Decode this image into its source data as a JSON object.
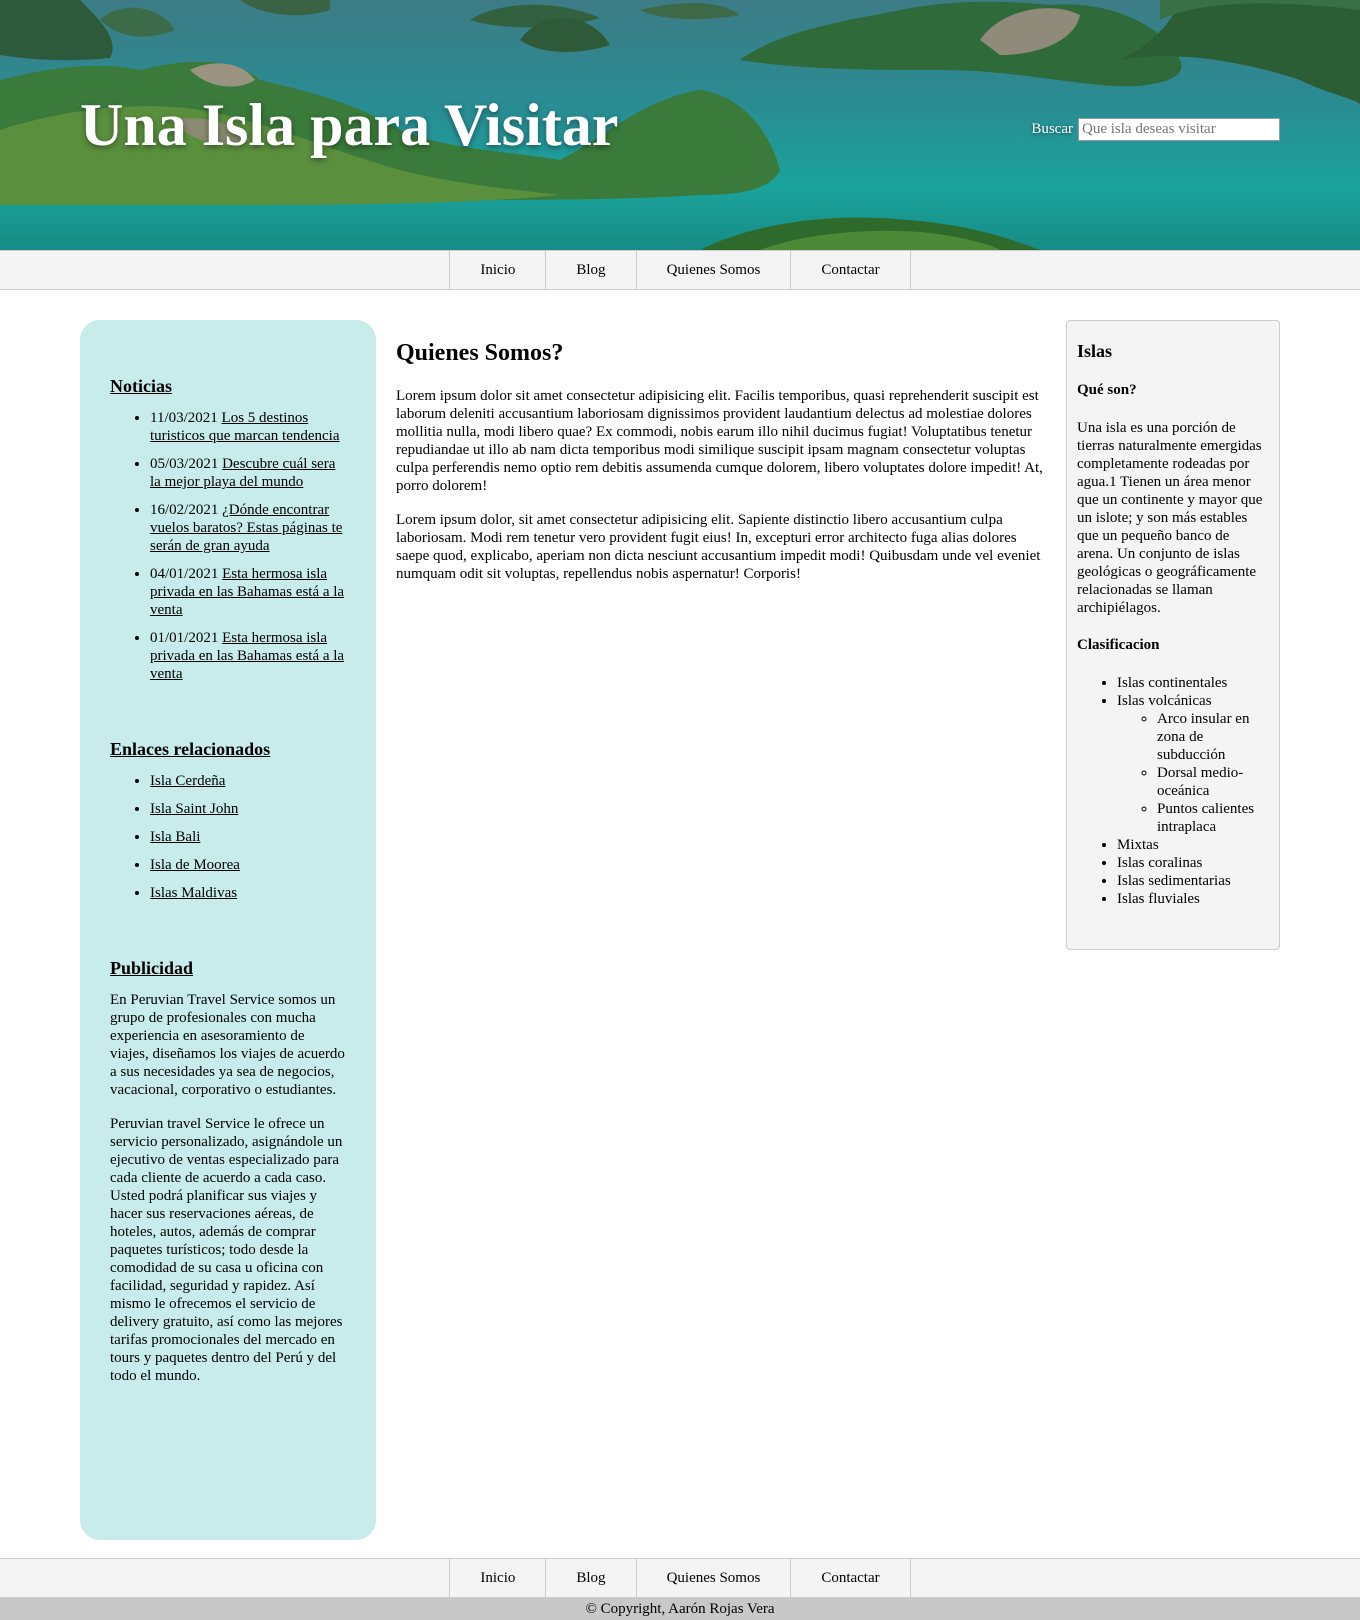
{
  "header": {
    "title": "Una Isla para Visitar",
    "search_label": "Buscar",
    "search_placeholder": "Que isla deseas visitar"
  },
  "nav": {
    "items": [
      "Inicio",
      "Blog",
      "Quienes Somos",
      "Contactar"
    ]
  },
  "sidebar": {
    "news_title": "Noticias",
    "news": [
      {
        "date": "11/03/2021",
        "text": "Los 5 destinos turisticos que marcan tendencia"
      },
      {
        "date": "05/03/2021",
        "text": "Descubre cuál sera la mejor playa del mundo"
      },
      {
        "date": "16/02/2021",
        "text": "¿Dónde encontrar vuelos baratos? Estas páginas te serán de gran ayuda"
      },
      {
        "date": "04/01/2021",
        "text": "Esta hermosa isla privada en las Bahamas está a la venta"
      },
      {
        "date": "01/01/2021",
        "text": "Esta hermosa isla privada en las Bahamas está a la venta"
      }
    ],
    "links_title": "Enlaces relacionados",
    "links": [
      "Isla Cerdeña",
      "Isla Saint John",
      "Isla Bali",
      "Isla de Moorea",
      "Islas Maldivas"
    ],
    "ads_title": "Publicidad",
    "ads_paragraphs": [
      "En Peruvian Travel Service somos un grupo de profesionales con mucha experiencia en asesoramiento de viajes, diseñamos los viajes de acuerdo a sus necesidades ya sea de negocios, vacacional, corporativo o estudiantes.",
      "Peruvian travel Service le ofrece un servicio personalizado, asignándole un ejecutivo de ventas especializado para cada cliente de acuerdo a cada caso. Usted podrá planificar sus viajes y hacer sus reservaciones aéreas, de hoteles, autos, además de comprar paquetes turísticos; todo desde la comodidad de su casa u oficina con facilidad, seguridad y rapidez. Así mismo le ofrecemos el servicio de delivery gratuito, así como las mejores tarifas promocionales del mercado en tours y paquetes dentro del Perú y del todo el mundo."
    ]
  },
  "content": {
    "title": "Quienes Somos?",
    "paragraphs": [
      "Lorem ipsum dolor sit amet consectetur adipisicing elit. Facilis temporibus, quasi reprehenderit suscipit est laborum deleniti accusantium laboriosam dignissimos provident laudantium delectus ad molestiae dolores mollitia nulla, modi libero quae? Ex commodi, nobis earum illo nihil ducimus fugiat! Voluptatibus tenetur repudiandae ut illo ab nam dicta temporibus modi similique suscipit ipsam magnam consectetur voluptas culpa perferendis nemo optio rem debitis assumenda cumque dolorem, libero voluptates dolore impedit! At, porro dolorem!",
      "Lorem ipsum dolor, sit amet consectetur adipisicing elit. Sapiente distinctio libero accusantium culpa laboriosam. Modi rem tenetur vero provident fugit eius! In, excepturi error architecto fuga alias dolores saepe quod, explicabo, aperiam non dicta nesciunt accusantium impedit modi! Quibusdam unde vel eveniet numquam odit sit voluptas, repellendus nobis aspernatur! Corporis!"
    ]
  },
  "aside": {
    "title": "Islas",
    "q_title": "Qué son?",
    "q_text": "Una isla es una porción de tierras naturalmente emergidas completamente rodeadas por agua.1 Tienen un área menor que un continente y mayor que un islote; y son más estables que un pequeño banco de arena. Un conjunto de islas geológicas o geográficamente relacionadas se llaman archipiélagos.",
    "class_title": "Clasificacion",
    "items": [
      "Islas continentales",
      "Islas volcánicas",
      "Mixtas",
      "Islas coralinas",
      "Islas sedimentarias",
      "Islas fluviales"
    ],
    "volcanic_sub": [
      "Arco insular en zona de subducción",
      "Dorsal medio-oceánica",
      "Puntos calientes intraplaca"
    ]
  },
  "footer": {
    "copyright": "© Copyright, Aarón Rojas Vera"
  }
}
